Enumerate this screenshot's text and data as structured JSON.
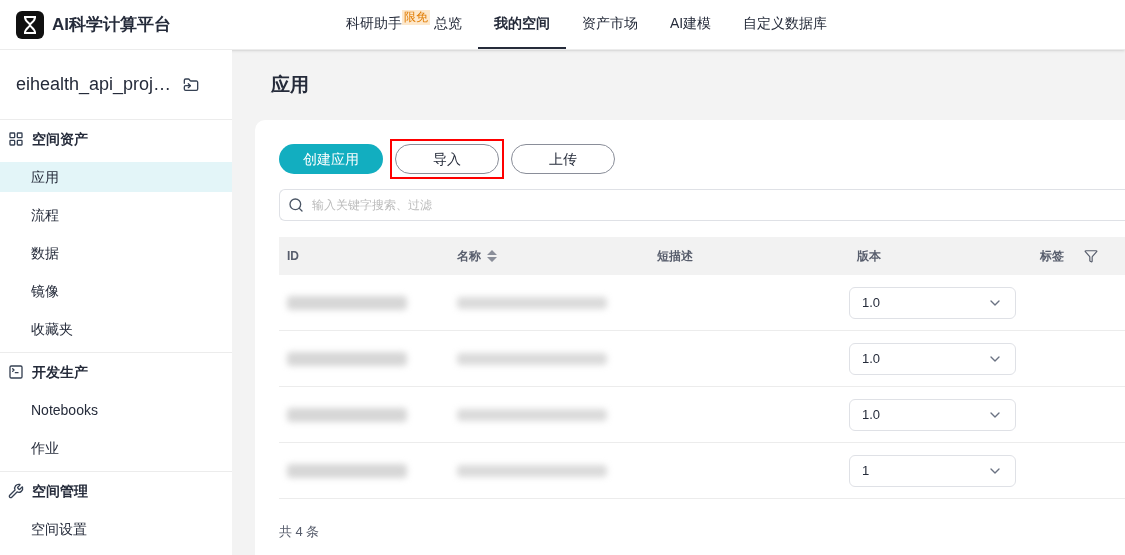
{
  "brand": {
    "title": "AI科学计算平台"
  },
  "nav": [
    {
      "label": "科研助手",
      "badge": "限免",
      "selected": false
    },
    {
      "label": "总览",
      "selected": false
    },
    {
      "label": "我的空间",
      "selected": true
    },
    {
      "label": "资产市场",
      "selected": false
    },
    {
      "label": "AI建模",
      "selected": false
    },
    {
      "label": "自定义数据库",
      "selected": false
    }
  ],
  "sidebar": {
    "project": "eihealth_api_proj…",
    "groups": [
      {
        "title": "空间资产",
        "kind": "grid",
        "items": [
          {
            "label": "应用",
            "selected": true
          },
          {
            "label": "流程",
            "selected": false
          },
          {
            "label": "数据",
            "selected": false
          },
          {
            "label": "镜像",
            "selected": false
          },
          {
            "label": "收藏夹",
            "selected": false
          }
        ]
      },
      {
        "title": "开发生产",
        "kind": "terminal",
        "items": [
          {
            "label": "Notebooks",
            "selected": false
          },
          {
            "label": "作业",
            "selected": false
          }
        ]
      },
      {
        "title": "空间管理",
        "kind": "wrench",
        "items": [
          {
            "label": "空间设置",
            "selected": false
          }
        ]
      }
    ]
  },
  "page": {
    "title": "应用"
  },
  "actions": [
    {
      "label": "创建应用",
      "kind": "primary",
      "highlighted": false
    },
    {
      "label": "导入",
      "kind": "outline",
      "highlighted": true
    },
    {
      "label": "上传",
      "kind": "outline",
      "highlighted": false
    }
  ],
  "search": {
    "placeholder": "输入关键字搜索、过滤"
  },
  "table": {
    "columns": [
      "ID",
      "名称",
      "短描述",
      "版本",
      "标签"
    ],
    "rows": [
      {
        "version": "1.0"
      },
      {
        "version": "1.0"
      },
      {
        "version": "1.0"
      },
      {
        "version": "1"
      }
    ]
  },
  "footer": {
    "total": "共 4 条"
  }
}
